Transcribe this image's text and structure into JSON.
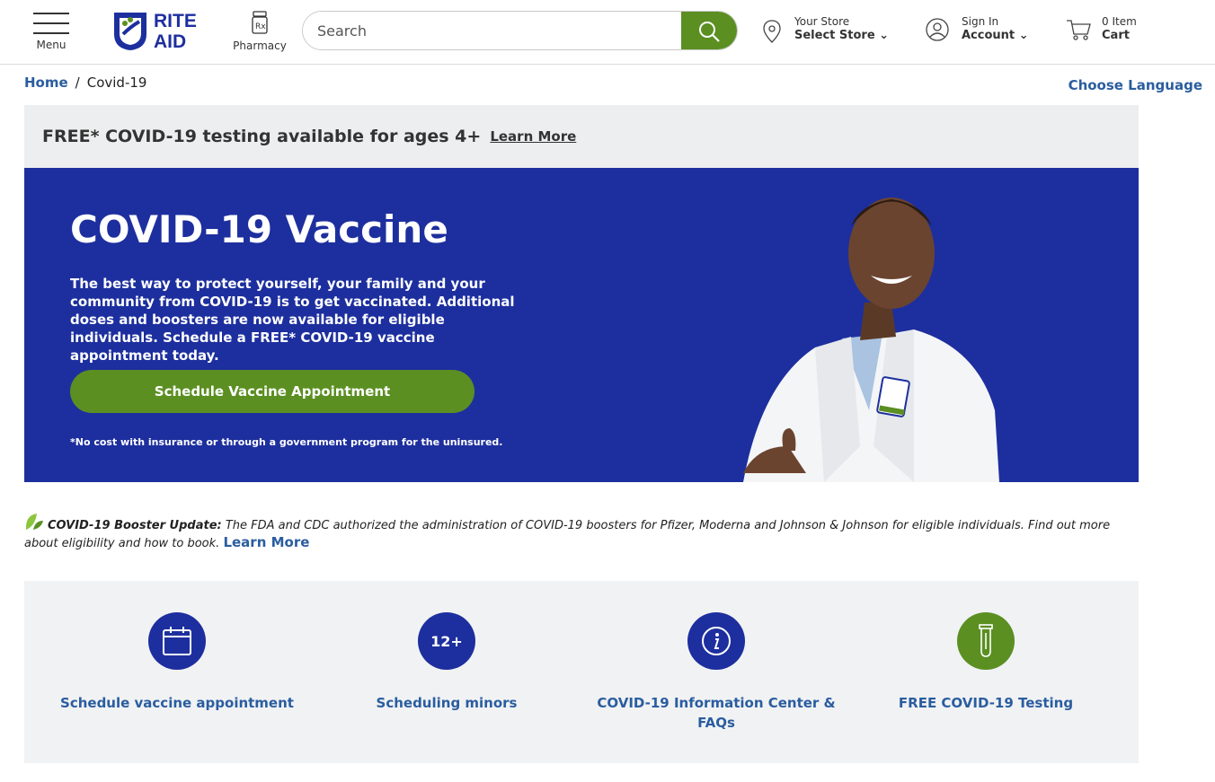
{
  "header": {
    "menu_label": "Menu",
    "logo_line1": "RITE",
    "logo_line2": "AID",
    "pharmacy_label": "Pharmacy",
    "search_placeholder": "Search",
    "store_top": "Your Store",
    "store_bottom": "Select Store",
    "account_top": "Sign In",
    "account_bottom": "Account",
    "cart_top": "0 Item",
    "cart_bottom": "Cart"
  },
  "breadcrumb": {
    "home": "Home",
    "separator": "/",
    "current": "Covid-19"
  },
  "choose_language": "Choose Language",
  "testing_banner": {
    "message": "FREE* COVID-19 testing available for ages 4+",
    "link": "Learn More"
  },
  "hero": {
    "title": "COVID-19 Vaccine",
    "body": "The best way to protect yourself, your family and your community from COVID-19 is to get vaccinated. Additional doses and boosters are now available for eligible individuals. Schedule a FREE* COVID-19 vaccine appointment today.",
    "button": "Schedule Vaccine Appointment",
    "note": "*No cost with insurance or through a government program for the uninsured."
  },
  "booster": {
    "title": "COVID-19 Booster Update:",
    "text": "The FDA and CDC authorized the administration of COVID-19 boosters for Pfizer, Moderna and Johnson & Johnson for eligible individuals. Find out more about eligibility and how to book.",
    "link": "Learn More"
  },
  "quick_links": [
    {
      "label": "Schedule vaccine appointment",
      "icon": "calendar-icon"
    },
    {
      "label": "Scheduling minors",
      "icon_text": "12+"
    },
    {
      "label": "COVID-19 Information Center & FAQs",
      "icon": "info-icon"
    },
    {
      "label": "FREE COVID-19 Testing",
      "icon": "test-tube-icon"
    }
  ],
  "colors": {
    "brand_blue": "#1d2f9e",
    "brand_green": "#5b8f22",
    "link_blue": "#2a5d9f"
  }
}
